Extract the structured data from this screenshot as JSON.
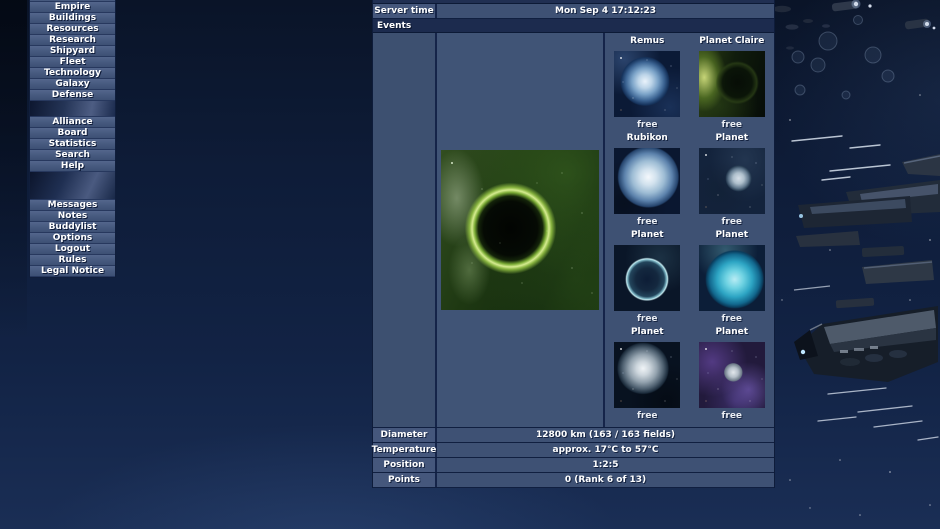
{
  "sidebar": {
    "group1": [
      "Empire",
      "Buildings",
      "Resources",
      "Research",
      "Shipyard",
      "Fleet",
      "Technology",
      "Galaxy",
      "Defense"
    ],
    "group2": [
      "Alliance",
      "Board",
      "Statistics",
      "Search",
      "Help"
    ],
    "group3": [
      "Messages",
      "Notes",
      "Buddylist",
      "Options",
      "Logout",
      "Rules",
      "Legal Notice"
    ]
  },
  "panel": {
    "server_time": {
      "label": "Server time",
      "value": "Mon Sep 4 17:12:23"
    },
    "events": {
      "label": "Events"
    },
    "moons": [
      {
        "name": "Remus",
        "status": "free"
      },
      {
        "name": "Planet Claire",
        "status": "free"
      },
      {
        "name": "Rubikon",
        "status": "free"
      },
      {
        "name": "Planet",
        "status": "free"
      },
      {
        "name": "Planet",
        "status": "free"
      },
      {
        "name": "Planet",
        "status": "free"
      },
      {
        "name": "Planet",
        "status": "free"
      },
      {
        "name": "Planet",
        "status": "free"
      }
    ],
    "info": [
      {
        "label": "Diameter",
        "value": "12800 km (163 / 163 fields)"
      },
      {
        "label": "Temperature",
        "value": "approx. 17°C to 57°C"
      },
      {
        "label": "Position",
        "value": "1:2:5"
      },
      {
        "label": "Points",
        "value": "0 (Rank 6 of 13)"
      }
    ]
  },
  "theme": {
    "header_bg": "#1c2b4e",
    "label_cell_bg": "#45577c",
    "value_cell_bg": "#3e5174",
    "menu_bg": "#46597e",
    "background": "#122345"
  }
}
